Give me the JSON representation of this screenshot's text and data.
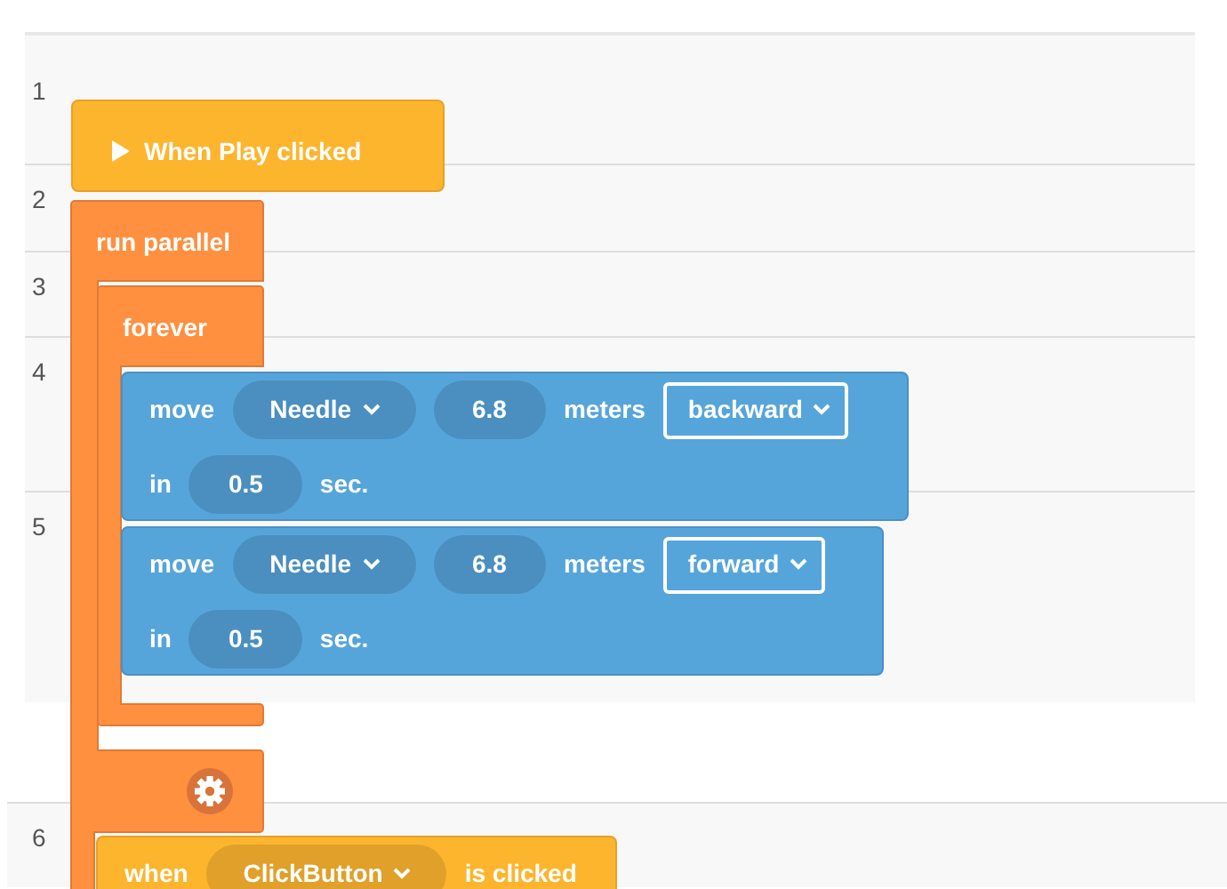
{
  "line_numbers": [
    "1",
    "2",
    "3",
    "4",
    "5",
    "6"
  ],
  "blocks": [
    {
      "kind": "hat",
      "label": "When Play clicked"
    },
    {
      "kind": "c-block",
      "label": "run parallel"
    },
    {
      "kind": "c-block",
      "label": "forever"
    },
    {
      "kind": "motion",
      "lines": [
        {
          "parts": [
            {
              "kind": "text",
              "text": "move"
            },
            {
              "kind": "menu",
              "text": "Needle"
            },
            {
              "kind": "number",
              "text": "6.8"
            },
            {
              "kind": "text",
              "text": "meters"
            },
            {
              "kind": "select",
              "text": "backward"
            }
          ]
        },
        {
          "parts": [
            {
              "kind": "text",
              "text": "in"
            },
            {
              "kind": "number",
              "text": "0.5"
            },
            {
              "kind": "text",
              "text": "sec."
            }
          ]
        }
      ]
    },
    {
      "kind": "motion",
      "lines": [
        {
          "parts": [
            {
              "kind": "text",
              "text": "move"
            },
            {
              "kind": "menu",
              "text": "Needle"
            },
            {
              "kind": "number",
              "text": "6.8"
            },
            {
              "kind": "text",
              "text": "meters"
            },
            {
              "kind": "select",
              "text": "forward"
            }
          ]
        },
        {
          "parts": [
            {
              "kind": "text",
              "text": "in"
            },
            {
              "kind": "number",
              "text": "0.5"
            },
            {
              "kind": "text",
              "text": "sec."
            }
          ]
        }
      ]
    },
    {
      "kind": "event",
      "lines": [
        {
          "parts": [
            {
              "kind": "text",
              "text": "when"
            },
            {
              "kind": "menu",
              "text": "ClickButton"
            },
            {
              "kind": "text",
              "text": "is clicked"
            }
          ]
        }
      ]
    }
  ]
}
